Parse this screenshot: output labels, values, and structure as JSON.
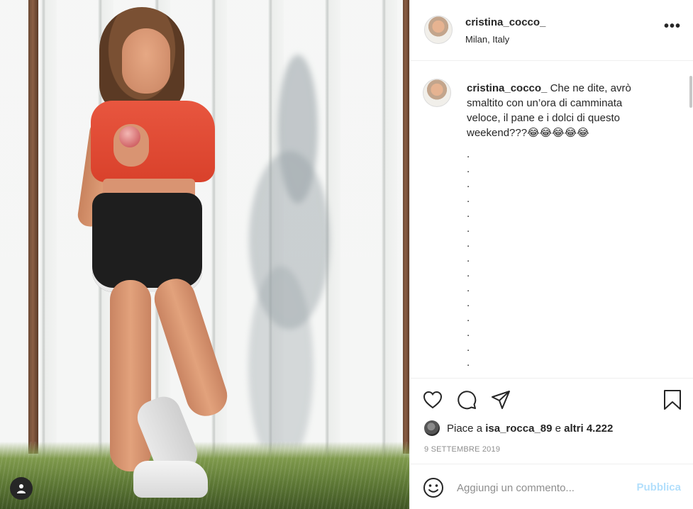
{
  "post": {
    "username": "cristina_cocco_",
    "location": "Milan, Italy",
    "more_label": "•••"
  },
  "caption": {
    "username": "cristina_cocco_",
    "text": "Che ne dite, avrò smaltito con un’ora di camminata veloce, il pane e i dolci di questo weekend???😂😂😂😂😂",
    "dots": [
      ".",
      ".",
      ".",
      ".",
      ".",
      ".",
      ".",
      ".",
      ".",
      ".",
      ".",
      ".",
      ".",
      ".",
      ".",
      "."
    ]
  },
  "actions": {
    "icons": [
      "heart-icon",
      "comment-icon",
      "share-icon",
      "bookmark-icon"
    ]
  },
  "likes": {
    "prefix": "Piace a",
    "user": "isa_rocca_89",
    "connector": "e",
    "others": "altri 4.222"
  },
  "date": "9 SETTEMBRE 2019",
  "comment": {
    "placeholder": "Aggiungi un commento...",
    "publish_label": "Pubblica",
    "publish_color": "#b2dffc"
  },
  "colors": {
    "text": "#262626",
    "muted": "#8e8e8e",
    "border": "#efefef"
  }
}
